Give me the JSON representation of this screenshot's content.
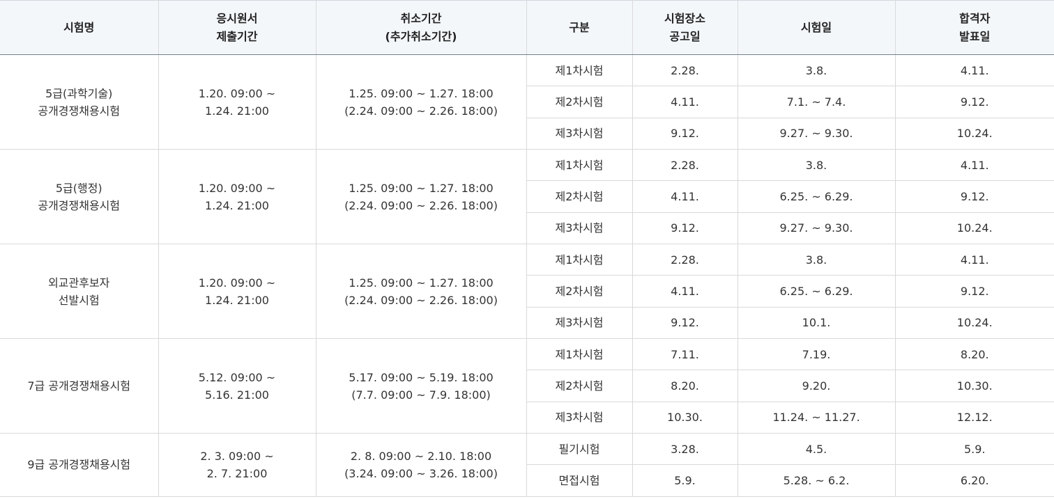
{
  "headers": [
    [
      "시험명"
    ],
    [
      "응시원서",
      "제출기간"
    ],
    [
      "취소기간",
      "(추가취소기간)"
    ],
    [
      "구분"
    ],
    [
      "시험장소",
      "공고일"
    ],
    [
      "시험일"
    ],
    [
      "합격자",
      "발표일"
    ]
  ],
  "groups": [
    {
      "name": [
        "5급(과학기술)",
        "공개경쟁채용시험"
      ],
      "apply": [
        "1.20. 09:00 ~",
        "1.24. 21:00"
      ],
      "cancel": [
        "1.25. 09:00 ~ 1.27. 18:00",
        "(2.24. 09:00 ~ 2.26. 18:00)"
      ],
      "rows": [
        {
          "type": "제1차시험",
          "venue": "2.28.",
          "exam": "3.8.",
          "result": "4.11."
        },
        {
          "type": "제2차시험",
          "venue": "4.11.",
          "exam": "7.1. ~ 7.4.",
          "result": "9.12."
        },
        {
          "type": "제3차시험",
          "venue": "9.12.",
          "exam": "9.27. ~ 9.30.",
          "result": "10.24."
        }
      ]
    },
    {
      "name": [
        "5급(행정)",
        "공개경쟁채용시험"
      ],
      "apply": [
        "1.20. 09:00 ~",
        "1.24. 21:00"
      ],
      "cancel": [
        "1.25. 09:00 ~ 1.27. 18:00",
        "(2.24. 09:00 ~ 2.26. 18:00)"
      ],
      "rows": [
        {
          "type": "제1차시험",
          "venue": "2.28.",
          "exam": "3.8.",
          "result": "4.11."
        },
        {
          "type": "제2차시험",
          "venue": "4.11.",
          "exam": "6.25. ~ 6.29.",
          "result": "9.12."
        },
        {
          "type": "제3차시험",
          "venue": "9.12.",
          "exam": "9.27. ~ 9.30.",
          "result": "10.24."
        }
      ]
    },
    {
      "name": [
        "외교관후보자",
        "선발시험"
      ],
      "apply": [
        "1.20. 09:00 ~",
        "1.24. 21:00"
      ],
      "cancel": [
        "1.25. 09:00 ~ 1.27. 18:00",
        "(2.24. 09:00 ~ 2.26. 18:00)"
      ],
      "rows": [
        {
          "type": "제1차시험",
          "venue": "2.28.",
          "exam": "3.8.",
          "result": "4.11."
        },
        {
          "type": "제2차시험",
          "venue": "4.11.",
          "exam": "6.25. ~ 6.29.",
          "result": "9.12."
        },
        {
          "type": "제3차시험",
          "venue": "9.12.",
          "exam": "10.1.",
          "result": "10.24."
        }
      ]
    },
    {
      "name": [
        "7급 공개경쟁채용시험"
      ],
      "apply": [
        "5.12. 09:00 ~",
        "5.16. 21:00"
      ],
      "cancel": [
        "5.17. 09:00 ~ 5.19. 18:00",
        "(7.7. 09:00 ~ 7.9. 18:00)"
      ],
      "rows": [
        {
          "type": "제1차시험",
          "venue": "7.11.",
          "exam": "7.19.",
          "result": "8.20."
        },
        {
          "type": "제2차시험",
          "venue": "8.20.",
          "exam": "9.20.",
          "result": "10.30."
        },
        {
          "type": "제3차시험",
          "venue": "10.30.",
          "exam": "11.24. ~ 11.27.",
          "result": "12.12."
        }
      ]
    },
    {
      "name": [
        "9급 공개경쟁채용시험"
      ],
      "apply": [
        "2. 3. 09:00 ~",
        "2. 7. 21:00"
      ],
      "cancel": [
        "2. 8. 09:00 ~ 2.10. 18:00",
        "(3.24. 09:00 ~ 3.26. 18:00)"
      ],
      "rows": [
        {
          "type": "필기시험",
          "venue": "3.28.",
          "exam": "4.5.",
          "result": "5.9."
        },
        {
          "type": "면접시험",
          "venue": "5.9.",
          "exam": "5.28. ~ 6.2.",
          "result": "6.20."
        }
      ]
    }
  ]
}
